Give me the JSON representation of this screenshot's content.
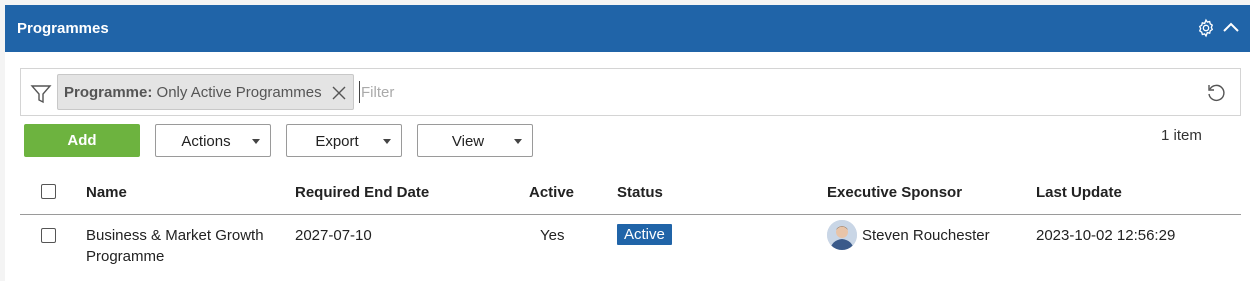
{
  "header": {
    "title": "Programmes",
    "icons": [
      "gear-icon",
      "chevron-up-icon"
    ]
  },
  "filter": {
    "chip_key": "Programme:",
    "chip_value": "Only Active Programmes",
    "placeholder": "Filter",
    "value": ""
  },
  "toolbar": {
    "add_label": "Add",
    "actions_label": "Actions",
    "export_label": "Export",
    "view_label": "View",
    "item_count": "1 item"
  },
  "table": {
    "columns": [
      "Name",
      "Required End Date",
      "Active",
      "Status",
      "Executive Sponsor",
      "Last Update"
    ],
    "rows": [
      {
        "name_line1": "Business & Market Growth",
        "name_line2": "Programme",
        "required_end_date": "2027-07-10",
        "active": "Yes",
        "status": "Active",
        "executive_sponsor": "Steven Rouchester",
        "last_update": "2023-10-02 12:56:29"
      }
    ]
  },
  "colors": {
    "header_bg": "#2064a8",
    "add_button": "#6db33f",
    "status_badge": "#2064a8"
  }
}
